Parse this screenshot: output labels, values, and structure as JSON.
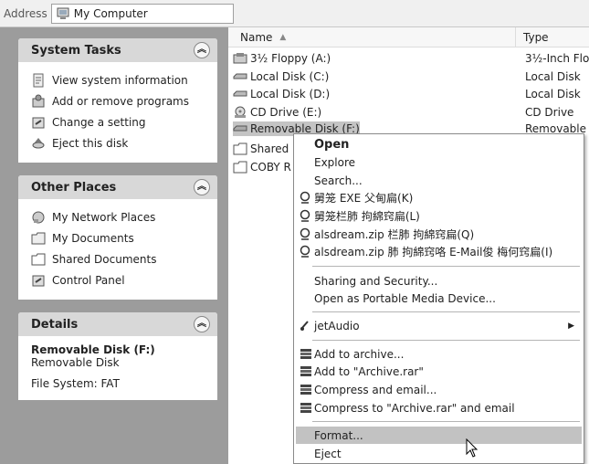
{
  "address_bar": {
    "label": "Address",
    "location": "My Computer"
  },
  "left_pane": {
    "system_tasks": {
      "title": "System Tasks",
      "items": [
        {
          "label": "View system information",
          "icon": "system-info-icon"
        },
        {
          "label": "Add or remove programs",
          "icon": "add-remove-programs-icon"
        },
        {
          "label": "Change a setting",
          "icon": "control-panel-icon"
        },
        {
          "label": "Eject this disk",
          "icon": "eject-disk-icon"
        }
      ]
    },
    "other_places": {
      "title": "Other Places",
      "items": [
        {
          "label": "My Network Places",
          "icon": "network-places-icon"
        },
        {
          "label": "My Documents",
          "icon": "my-documents-icon"
        },
        {
          "label": "Shared Documents",
          "icon": "folder-icon"
        },
        {
          "label": "Control Panel",
          "icon": "control-panel-icon"
        }
      ]
    },
    "details": {
      "title": "Details",
      "name": "Removable Disk (F:)",
      "type": "Removable Disk",
      "filesystem": "File System: FAT"
    }
  },
  "file_list": {
    "columns": {
      "name": "Name",
      "type": "Type"
    },
    "rows": [
      {
        "name": "3½ Floppy (A:)",
        "type": "3½-Inch Flo",
        "icon": "floppy-drive-icon"
      },
      {
        "name": "Local Disk (C:)",
        "type": "Local Disk",
        "icon": "hard-disk-icon"
      },
      {
        "name": "Local Disk (D:)",
        "type": "Local Disk",
        "icon": "hard-disk-icon"
      },
      {
        "name": "CD Drive (E:)",
        "type": "CD Drive",
        "icon": "cd-drive-icon"
      },
      {
        "name": "Removable Disk (F:)",
        "type": "Removable D",
        "icon": "removable-disk-icon",
        "selected": true
      },
      {
        "name": "Shared",
        "type": "",
        "icon": "folder-icon"
      },
      {
        "name": "COBY R",
        "type": "",
        "icon": "folder-icon"
      }
    ]
  },
  "context_menu": {
    "open": "Open",
    "explore": "Explore",
    "search": "Search...",
    "archive_items": [
      "舅笼 EXE 父甸扁(K)",
      "舅笼栏肺 拘綿窍扁(L)",
      "alsdream.zip 栏肺 拘綿窍扁(Q)",
      "alsdream.zip 肺 拘綿窍咯 E-Mail俊 梅何窍扁(I)"
    ],
    "sharing": "Sharing and Security...",
    "portable_media": "Open as Portable Media Device...",
    "jetaudio": "jetAudio",
    "rar_items": [
      "Add to archive...",
      "Add to \"Archive.rar\"",
      "Compress and email...",
      "Compress to \"Archive.rar\" and email"
    ],
    "format": "Format...",
    "eject": "Eject"
  }
}
